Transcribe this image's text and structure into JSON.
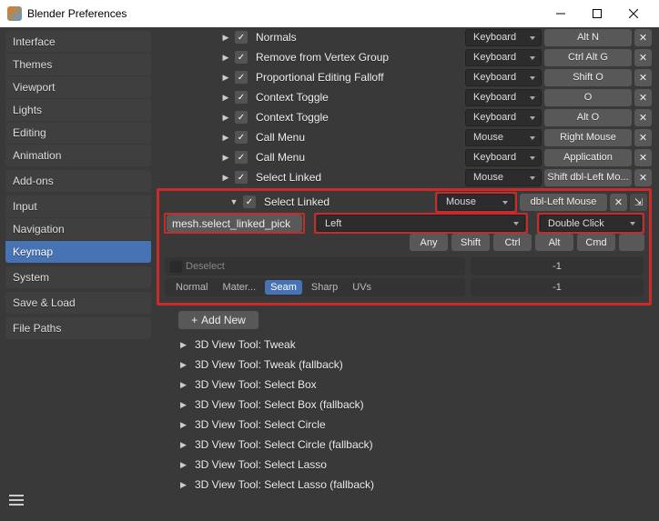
{
  "window": {
    "title": "Blender Preferences"
  },
  "sidebar": {
    "g1": [
      "Interface",
      "Themes",
      "Viewport",
      "Lights",
      "Editing",
      "Animation"
    ],
    "g2": [
      "Add-ons"
    ],
    "g3": [
      "Input",
      "Navigation",
      "Keymap"
    ],
    "g4": [
      "System"
    ],
    "g5": [
      "Save & Load"
    ],
    "g6": [
      "File Paths"
    ]
  },
  "km": [
    {
      "label": "Normals",
      "type": "Keyboard",
      "bind": "Alt N"
    },
    {
      "label": "Remove from Vertex Group",
      "type": "Keyboard",
      "bind": "Ctrl Alt G"
    },
    {
      "label": "Proportional Editing Falloff",
      "type": "Keyboard",
      "bind": "Shift O"
    },
    {
      "label": "Context Toggle",
      "type": "Keyboard",
      "bind": "O"
    },
    {
      "label": "Context Toggle",
      "type": "Keyboard",
      "bind": "Alt O"
    },
    {
      "label": "Call Menu",
      "type": "Mouse",
      "bind": "Right Mouse"
    },
    {
      "label": "Call Menu",
      "type": "Keyboard",
      "bind": "Application"
    },
    {
      "label": "Select Linked",
      "type": "Mouse",
      "bind": "Shift dbl-Left Mo..."
    }
  ],
  "expanded": {
    "label": "Select Linked",
    "type": "Mouse",
    "bind": "dbl-Left Mouse",
    "operator": "mesh.select_linked_pick",
    "mouse_btn": "Left",
    "event": "Double Click",
    "mods": [
      "Any",
      "Shift",
      "Ctrl",
      "Alt",
      "Cmd"
    ],
    "deselect": "Deselect",
    "deselect_val": "-1",
    "delimit": [
      "Normal",
      "Mater...",
      "Seam",
      "Sharp",
      "UVs"
    ],
    "delimit_val": "-1"
  },
  "addnew": "Add New",
  "tools": [
    "3D View Tool: Tweak",
    "3D View Tool: Tweak (fallback)",
    "3D View Tool: Select Box",
    "3D View Tool: Select Box (fallback)",
    "3D View Tool: Select Circle",
    "3D View Tool: Select Circle (fallback)",
    "3D View Tool: Select Lasso",
    "3D View Tool: Select Lasso (fallback)"
  ]
}
